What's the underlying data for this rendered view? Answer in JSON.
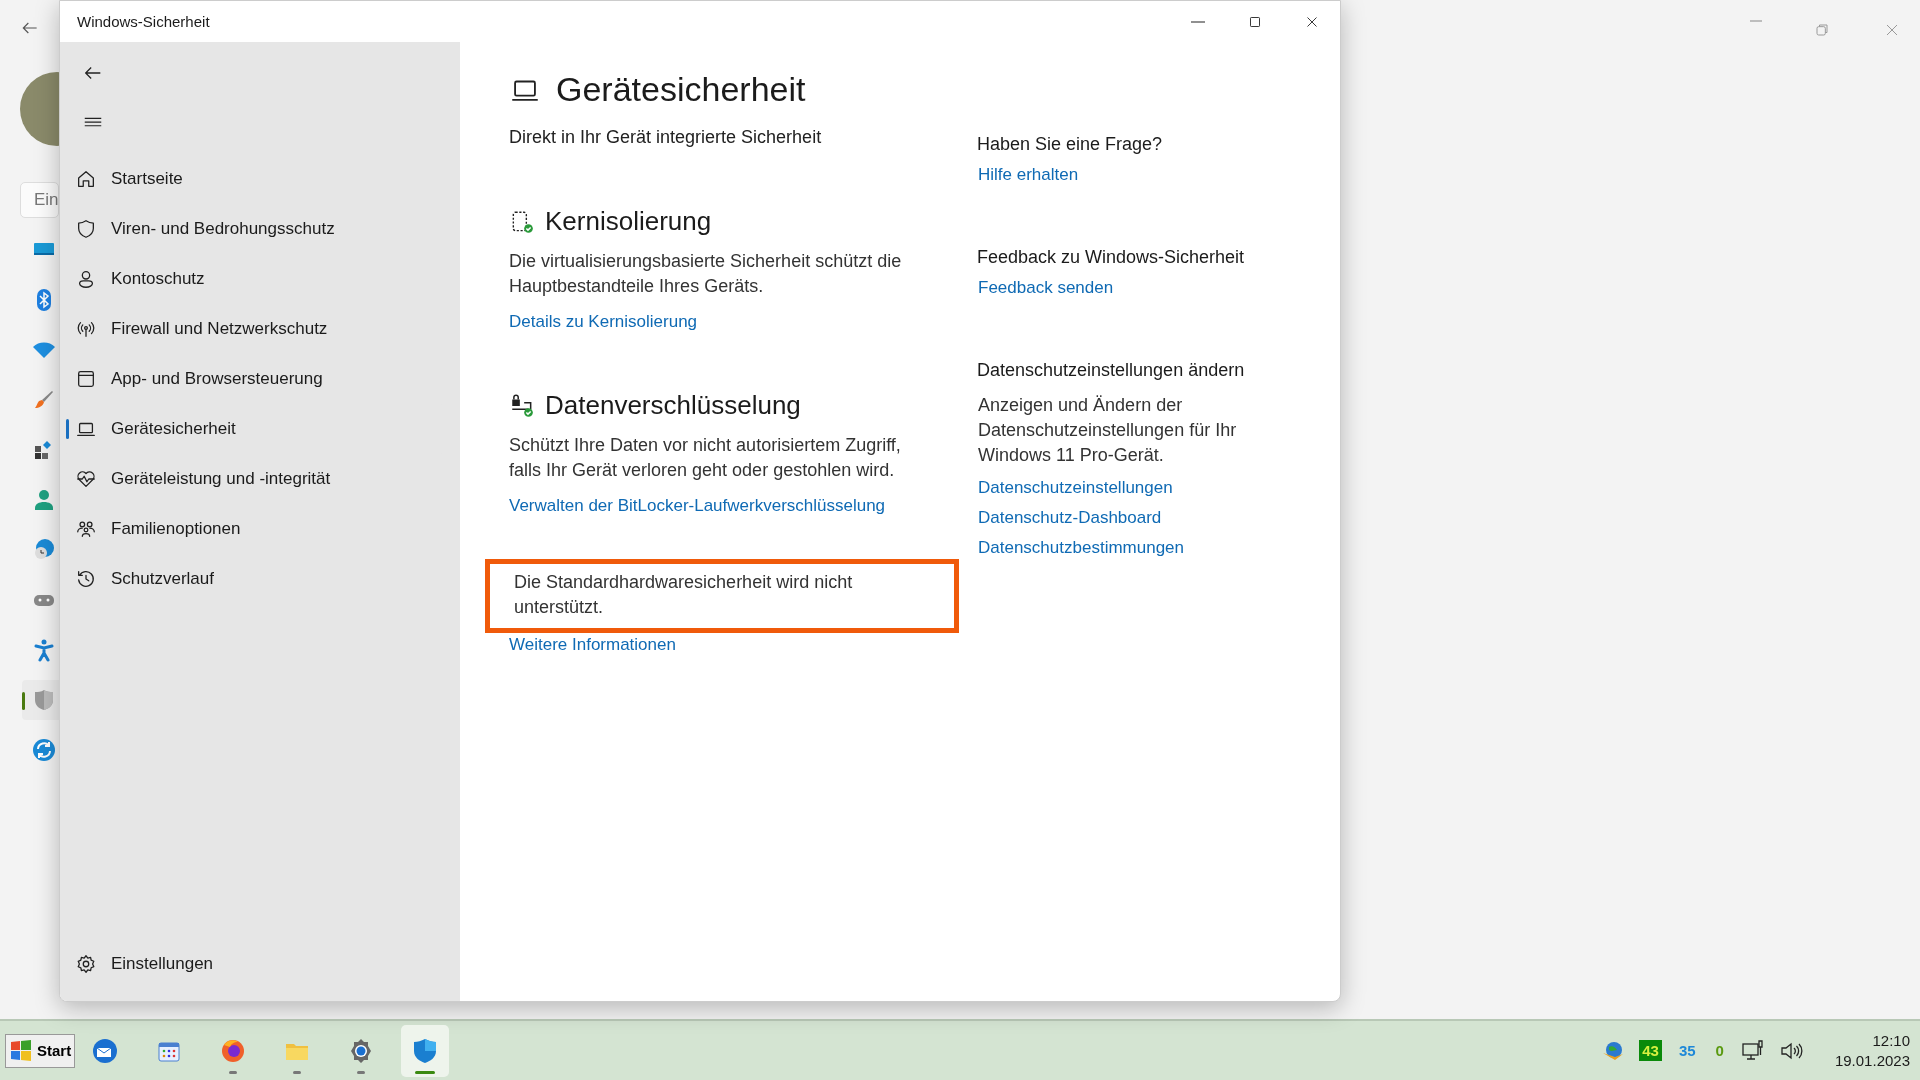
{
  "background_window": {
    "search": {
      "placeholder": "Ein"
    },
    "nav": [
      {
        "kind": "display",
        "selected": false
      },
      {
        "kind": "bluetooth",
        "selected": false
      },
      {
        "kind": "wifi",
        "selected": false
      },
      {
        "kind": "brush",
        "selected": false
      },
      {
        "kind": "apps",
        "selected": false
      },
      {
        "kind": "person",
        "selected": false
      },
      {
        "kind": "globe",
        "selected": false
      },
      {
        "kind": "gamepad",
        "selected": false
      },
      {
        "kind": "accessibility",
        "selected": false
      },
      {
        "kind": "shield",
        "selected": true
      },
      {
        "kind": "update",
        "selected": false
      }
    ]
  },
  "window": {
    "title": "Windows-Sicherheit"
  },
  "sidebar": {
    "items": [
      {
        "kind": "home",
        "label": "Startseite",
        "selected": false
      },
      {
        "kind": "shield",
        "label": "Viren- und Bedrohungsschutz",
        "selected": false
      },
      {
        "kind": "person",
        "label": "Kontoschutz",
        "selected": false
      },
      {
        "kind": "antenna",
        "label": "Firewall und Netzwerkschutz",
        "selected": false
      },
      {
        "kind": "browser",
        "label": "App- und Browsersteuerung",
        "selected": false
      },
      {
        "kind": "laptop",
        "label": "Gerätesicherheit",
        "selected": true
      },
      {
        "kind": "heart",
        "label": "Geräteleistung und -integrität",
        "selected": false
      },
      {
        "kind": "family",
        "label": "Familienoptionen",
        "selected": false
      },
      {
        "kind": "history",
        "label": "Schutzverlauf",
        "selected": false
      }
    ],
    "footer": {
      "kind": "gear",
      "label": "Einstellungen"
    }
  },
  "page": {
    "title": "Gerätesicherheit",
    "subtitle": "Direkt in Ihr Gerät integrierte Sicherheit",
    "sections": [
      {
        "kind": "core",
        "title": "Kernisolierung",
        "description": "Die virtualisierungsbasierte Sicherheit schützt die Hauptbestandteile Ihres Geräts.",
        "link": "Details zu Kernisolierung"
      },
      {
        "kind": "encryption",
        "title": "Datenverschlüsselung",
        "description": "Schützt Ihre Daten vor nicht autorisiertem Zugriff, falls Ihr Gerät verloren geht oder gestohlen wird.",
        "link": "Verwalten der BitLocker-Laufwerkverschlüsselung"
      }
    ],
    "notice": {
      "text": "Die Standardhardwaresicherheit wird nicht unterstützt.",
      "highlighted": true,
      "link": "Weitere Informationen"
    }
  },
  "aside": [
    {
      "title": "Haben Sie eine Frage?",
      "links": [
        "Hilfe erhalten"
      ]
    },
    {
      "title": "Feedback zu Windows-Sicherheit",
      "links": [
        "Feedback senden"
      ]
    },
    {
      "title": "Datenschutzeinstellungen ändern",
      "description": "Anzeigen und Ändern der Datenschutzeinstellungen für Ihr Windows 11 Pro-Gerät.",
      "links": [
        "Datenschutzeinstellungen",
        "Datenschutz-Dashboard",
        "Datenschutzbestimmungen"
      ]
    }
  ],
  "taskbar": {
    "start": "Start",
    "apps": [
      {
        "kind": "mail",
        "running": false,
        "active": false
      },
      {
        "kind": "calendar",
        "running": false,
        "active": false
      },
      {
        "kind": "firefox",
        "running": true,
        "active": false
      },
      {
        "kind": "folder",
        "running": true,
        "active": false
      },
      {
        "kind": "settings",
        "running": true,
        "active": false
      },
      {
        "kind": "security",
        "running": true,
        "active": true
      }
    ],
    "tray_counters": [
      {
        "text": "43",
        "color": "#0a8a0a"
      },
      {
        "text": "35",
        "color": "#1e88d8"
      },
      {
        "text": "0",
        "color": "#5a9a10"
      }
    ],
    "time": "12:10",
    "date": "19.01.2023"
  }
}
